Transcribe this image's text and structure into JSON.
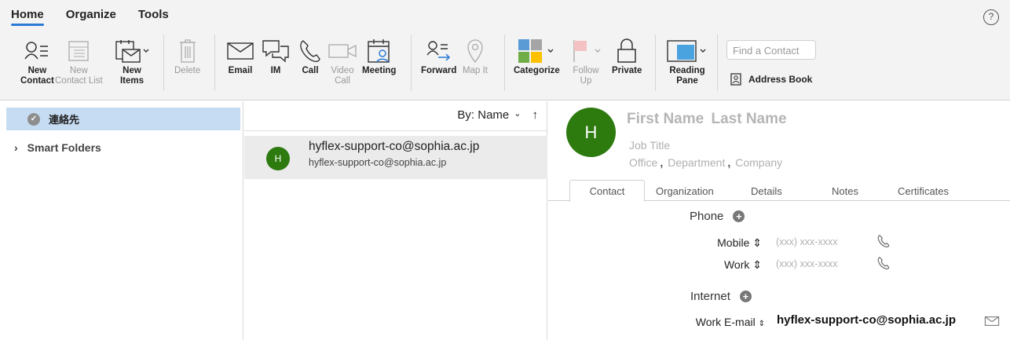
{
  "ribbon": {
    "tabs": [
      "Home",
      "Organize",
      "Tools"
    ],
    "buttons": [
      {
        "l1": "New",
        "l2": "Contact"
      },
      {
        "l1": "New",
        "l2": "Contact List"
      },
      {
        "l1": "New",
        "l2": "Items"
      },
      {
        "l1": "Delete",
        "l2": ""
      },
      {
        "l1": "Email",
        "l2": ""
      },
      {
        "l1": "IM",
        "l2": ""
      },
      {
        "l1": "Call",
        "l2": ""
      },
      {
        "l1": "Video",
        "l2": "Call"
      },
      {
        "l1": "Meeting",
        "l2": ""
      },
      {
        "l1": "Forward",
        "l2": ""
      },
      {
        "l1": "Map It",
        "l2": ""
      },
      {
        "l1": "Categorize",
        "l2": ""
      },
      {
        "l1": "Follow",
        "l2": "Up"
      },
      {
        "l1": "Private",
        "l2": ""
      },
      {
        "l1": "Reading",
        "l2": "Pane"
      }
    ],
    "find_placeholder": "Find a Contact",
    "address_book": "Address Book",
    "help": "?"
  },
  "sidebar": {
    "folder": "連絡先",
    "smart_folders": "Smart Folders"
  },
  "list": {
    "sort_label": "By: Name",
    "item": {
      "initial": "H",
      "name": "hyflex-support-co@sophia.ac.jp",
      "email": "hyflex-support-co@sophia.ac.jp"
    }
  },
  "detail": {
    "initial": "H",
    "first_name": "First Name",
    "last_name": "Last Name",
    "job_title": "Job Title",
    "office": "Office",
    "department": "Department",
    "company": "Company",
    "tabs": [
      "Contact",
      "Organization",
      "Details",
      "Notes",
      "Certificates"
    ],
    "phone_section": "Phone",
    "mobile_label": "Mobile",
    "work_label": "Work",
    "phone_placeholder": "(xxx) xxx-xxxx",
    "internet_section": "Internet",
    "work_email_label": "Work E-mail",
    "work_email_value": "hyflex-support-co@sophia.ac.jp"
  },
  "colors": {
    "accent": "#2a7ad6",
    "avatar": "#2d7a0f",
    "selection": "#c6dcf3"
  }
}
